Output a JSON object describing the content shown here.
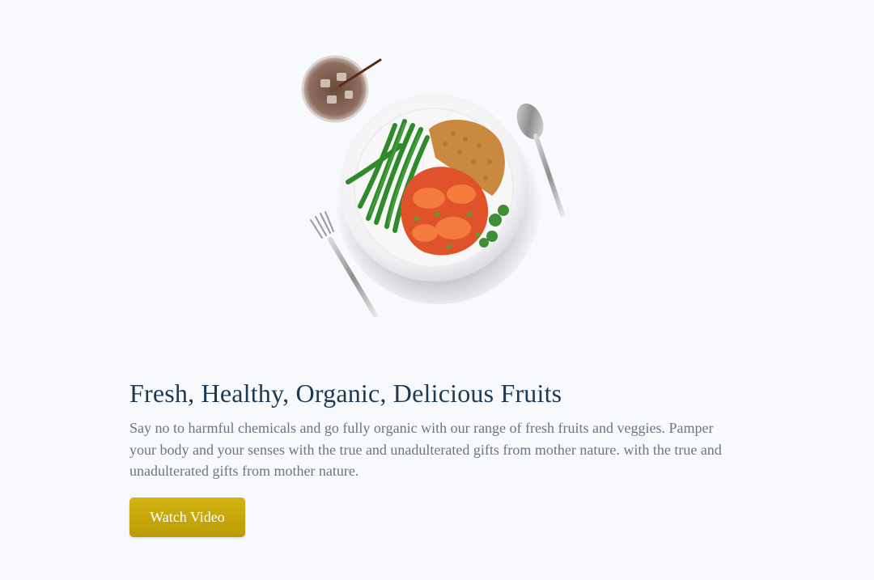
{
  "hero": {
    "image_name": "plate-of-food-with-drink-and-cutlery"
  },
  "content": {
    "title": "Fresh, Healthy, Organic, Delicious Fruits",
    "description": "Say no to harmful chemicals and go fully organic with our range of fresh fruits and veggies. Pamper your body and your senses with the true and unadulterated gifts from mother nature. with the true and unadulterated gifts from mother nature.",
    "button_label": "Watch Video"
  },
  "colors": {
    "background": "#f8f9fd",
    "title": "#1d3a52",
    "body_text": "#6b7583",
    "button": "#c9aa0a"
  }
}
